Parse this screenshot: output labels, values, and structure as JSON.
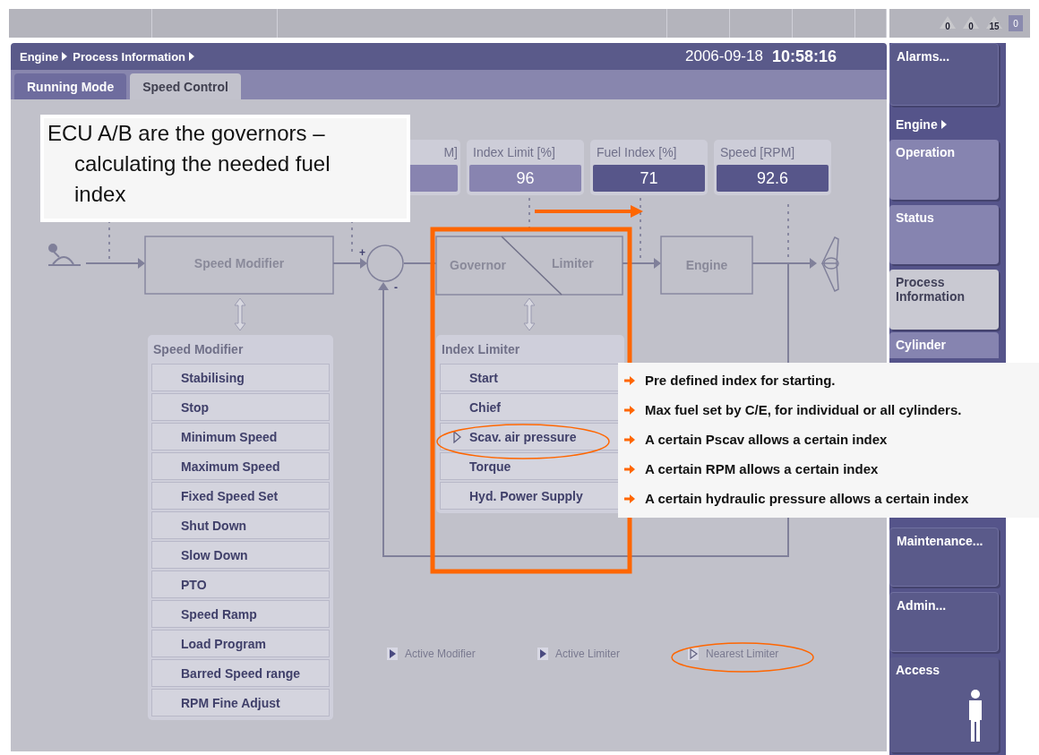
{
  "top_bar": {
    "alarm_counters": [
      "0",
      "0",
      "15"
    ],
    "indicator": "0"
  },
  "header": {
    "breadcrumb": [
      "Engine",
      "Process Information"
    ],
    "date": "2006-09-18",
    "time": "10:58:16"
  },
  "tabs": [
    {
      "label": "Running Mode",
      "selected": false
    },
    {
      "label": "Speed Control",
      "selected": true
    }
  ],
  "readouts": [
    {
      "label": "M]",
      "emphasis": false
    },
    {
      "label": "Index Limit [%]",
      "value": "96",
      "emphasis": false
    },
    {
      "label": "Fuel Index [%]",
      "value": "71",
      "emphasis": true
    },
    {
      "label": "Speed [RPM]",
      "value": "92.6",
      "emphasis": true
    }
  ],
  "diagram": {
    "speed_modifier_block": "Speed Modifier",
    "governor_label": "Governor",
    "limiter_label": "Limiter",
    "engine_block": "Engine",
    "plus_sign": "+",
    "minus_sign": "-"
  },
  "speed_modifier": {
    "title": "Speed Modifier",
    "items": [
      "Stabilising",
      "Stop",
      "Minimum Speed",
      "Maximum Speed",
      "Fixed Speed Set",
      "Shut Down",
      "Slow Down",
      "PTO",
      "Speed Ramp",
      "Load Program",
      "Barred Speed range",
      "RPM  Fine Adjust"
    ]
  },
  "index_limiter": {
    "title": "Index Limiter",
    "items": [
      {
        "label": "Start",
        "nearest": false
      },
      {
        "label": "Chief",
        "nearest": false
      },
      {
        "label": "Scav. air pressure",
        "nearest": true
      },
      {
        "label": "Torque",
        "nearest": false
      },
      {
        "label": "Hyd. Power Supply",
        "nearest": false
      }
    ]
  },
  "legend": [
    {
      "label": "Active Modifier",
      "kind": "active"
    },
    {
      "label": "Active Limiter",
      "kind": "active"
    },
    {
      "label": "Nearest Limiter",
      "kind": "nearest"
    }
  ],
  "sidebar": [
    {
      "label": "Alarms...",
      "kind": "dark",
      "selected": false
    },
    {
      "label": "Engine",
      "kind": "header"
    },
    {
      "label": "Operation",
      "kind": "button",
      "selected": false
    },
    {
      "label": "Status",
      "kind": "button",
      "selected": false
    },
    {
      "label": "Process Information",
      "kind": "button",
      "selected": true
    },
    {
      "label": "Cylinder",
      "kind": "cut",
      "selected": false
    },
    {
      "label": "Maintenance...",
      "kind": "dark",
      "selected": false
    },
    {
      "label": "Admin...",
      "kind": "dark",
      "selected": false
    },
    {
      "label": "Access",
      "kind": "access",
      "selected": false
    }
  ],
  "annotations": {
    "callout": "ECU A/B are the governors – calculating the needed fuel index",
    "notes": [
      "Pre defined index for starting.",
      "Max fuel set by C/E, for individual or all cylinders.",
      "A certain Pscav allows a certain index",
      "A certain RPM allows a certain index",
      "A certain hydraulic pressure allows a certain index"
    ]
  }
}
